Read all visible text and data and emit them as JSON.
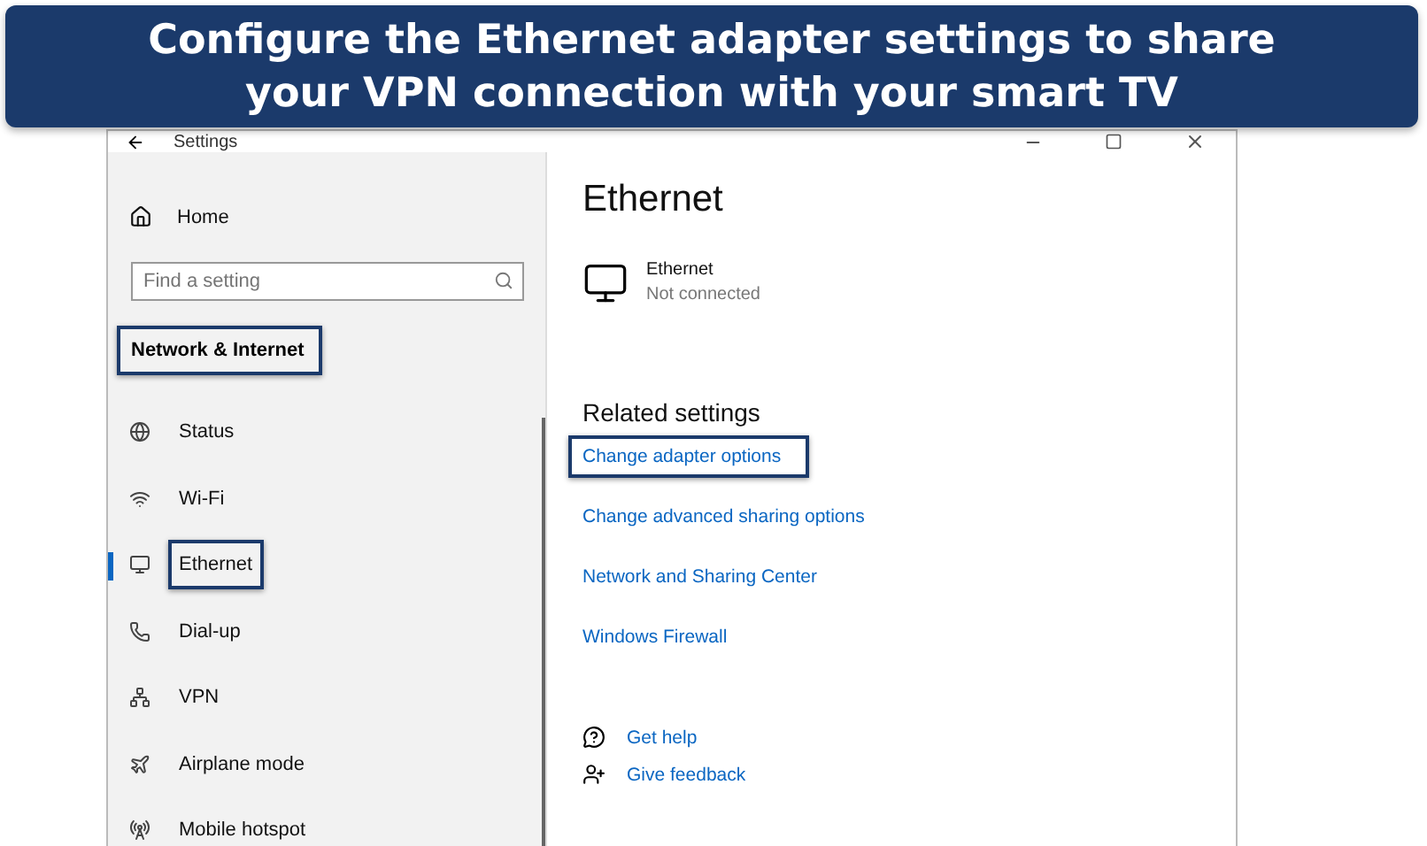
{
  "banner": {
    "lines": [
      "Configure the Ethernet adapter settings to share",
      "your VPN connection with your smart TV"
    ]
  },
  "window": {
    "title": "Settings"
  },
  "sidebar": {
    "home": "Home",
    "search": {
      "placeholder": "Find a setting"
    },
    "section": {
      "label": "Network & Internet",
      "highlighted": true
    },
    "items": [
      {
        "label": "Status",
        "kind": "status",
        "selected": false,
        "highlighted": false
      },
      {
        "label": "Wi-Fi",
        "kind": "wifi",
        "selected": false,
        "highlighted": false
      },
      {
        "label": "Ethernet",
        "kind": "ethernet",
        "selected": true,
        "highlighted": true
      },
      {
        "label": "Dial-up",
        "kind": "dialup",
        "selected": false,
        "highlighted": false
      },
      {
        "label": "VPN",
        "kind": "vpn",
        "selected": false,
        "highlighted": false
      },
      {
        "label": "Airplane mode",
        "kind": "airplane",
        "selected": false,
        "highlighted": false
      },
      {
        "label": "Mobile hotspot",
        "kind": "hotspot",
        "selected": false,
        "highlighted": false
      }
    ]
  },
  "content": {
    "title": "Ethernet",
    "adapter": {
      "name": "Ethernet",
      "status": "Not connected"
    },
    "related": {
      "heading": "Related settings",
      "links": [
        {
          "label": "Change adapter options",
          "highlighted": true
        },
        {
          "label": "Change advanced sharing options",
          "highlighted": false
        },
        {
          "label": "Network and Sharing Center",
          "highlighted": false
        },
        {
          "label": "Windows Firewall",
          "highlighted": false
        }
      ]
    },
    "help": [
      {
        "label": "Get help",
        "kind": "help"
      },
      {
        "label": "Give feedback",
        "kind": "feedback"
      }
    ]
  }
}
